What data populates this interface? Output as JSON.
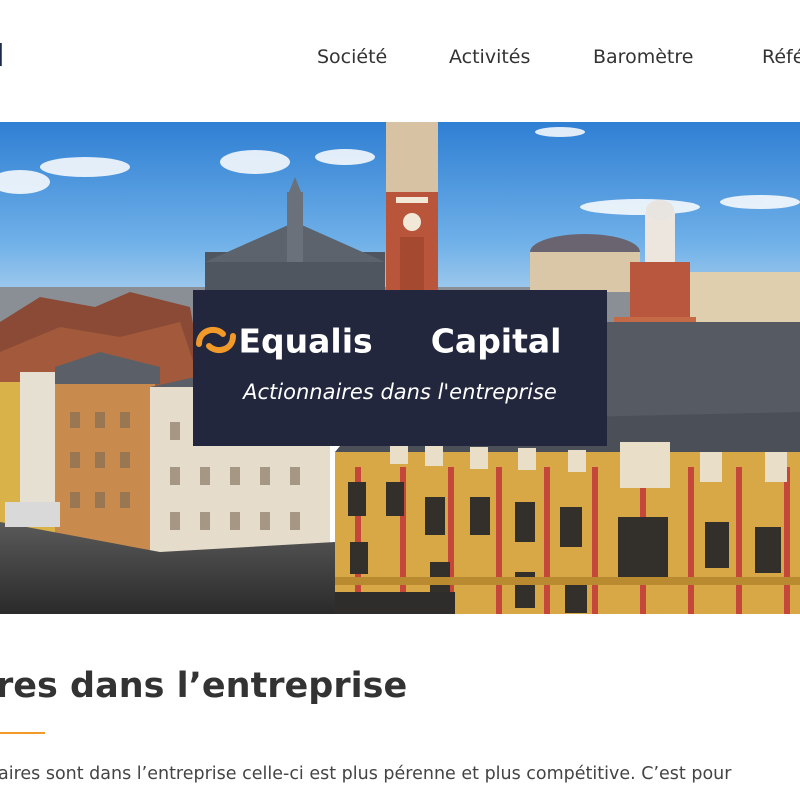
{
  "header": {
    "brand_fragment": "l",
    "nav": [
      {
        "label": "Société"
      },
      {
        "label": "Activités"
      },
      {
        "label": "Baromètre"
      },
      {
        "label": "Réfé"
      }
    ]
  },
  "hero": {
    "logo_word_1": "Equalis",
    "logo_word_2": "Capital",
    "tagline": "Actionnaires dans l'entreprise"
  },
  "content": {
    "title": "res dans l’entreprise",
    "paragraph_line_1": "aires sont dans l’entreprise celle-ci est plus pérenne et plus compétitive. C’est pour",
    "paragraph_line_2": "                                                                               "
  },
  "colors": {
    "navy": "#22273d",
    "brand_text": "#1e2a4a",
    "accent_orange": "#f19a2a"
  }
}
